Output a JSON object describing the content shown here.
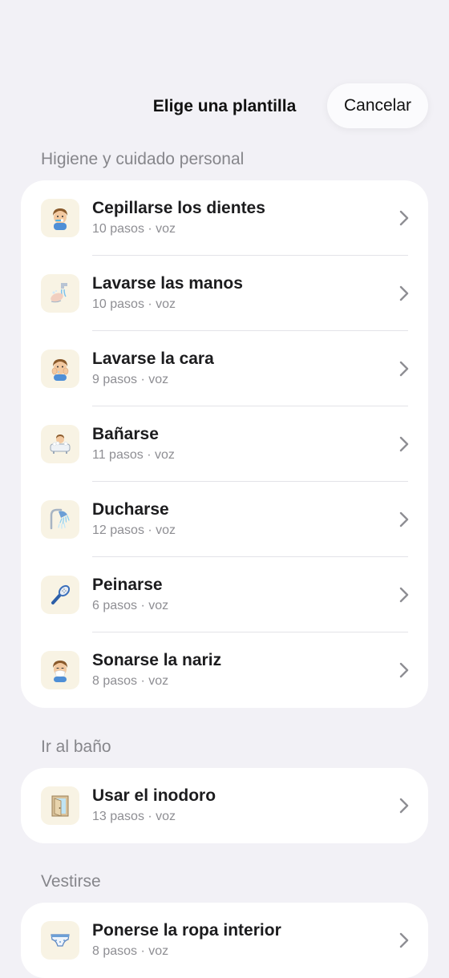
{
  "header": {
    "title": "Elige una plantilla",
    "cancel_label": "Cancelar"
  },
  "sections": [
    {
      "title": "Higiene y cuidado personal",
      "items": [
        {
          "title": "Cepillarse los dientes",
          "subtitle": "10 pasos · voz",
          "icon": "toothbrushing-child-icon"
        },
        {
          "title": "Lavarse las manos",
          "subtitle": "10 pasos · voz",
          "icon": "handwashing-icon"
        },
        {
          "title": "Lavarse la cara",
          "subtitle": "9 pasos · voz",
          "icon": "face-washing-child-icon"
        },
        {
          "title": "Bañarse",
          "subtitle": "11 pasos · voz",
          "icon": "bathtub-child-icon"
        },
        {
          "title": "Ducharse",
          "subtitle": "12 pasos · voz",
          "icon": "shower-head-icon"
        },
        {
          "title": "Peinarse",
          "subtitle": "6 pasos · voz",
          "icon": "hairbrush-icon"
        },
        {
          "title": "Sonarse la nariz",
          "subtitle": "8 pasos · voz",
          "icon": "nose-blowing-child-icon"
        }
      ]
    },
    {
      "title": "Ir al baño",
      "items": [
        {
          "title": "Usar el inodoro",
          "subtitle": "13 pasos · voz",
          "icon": "bathroom-door-icon"
        }
      ]
    },
    {
      "title": "Vestirse",
      "items": [
        {
          "title": "Ponerse la ropa interior",
          "subtitle": "8 pasos · voz",
          "icon": "underwear-icon"
        }
      ]
    }
  ]
}
